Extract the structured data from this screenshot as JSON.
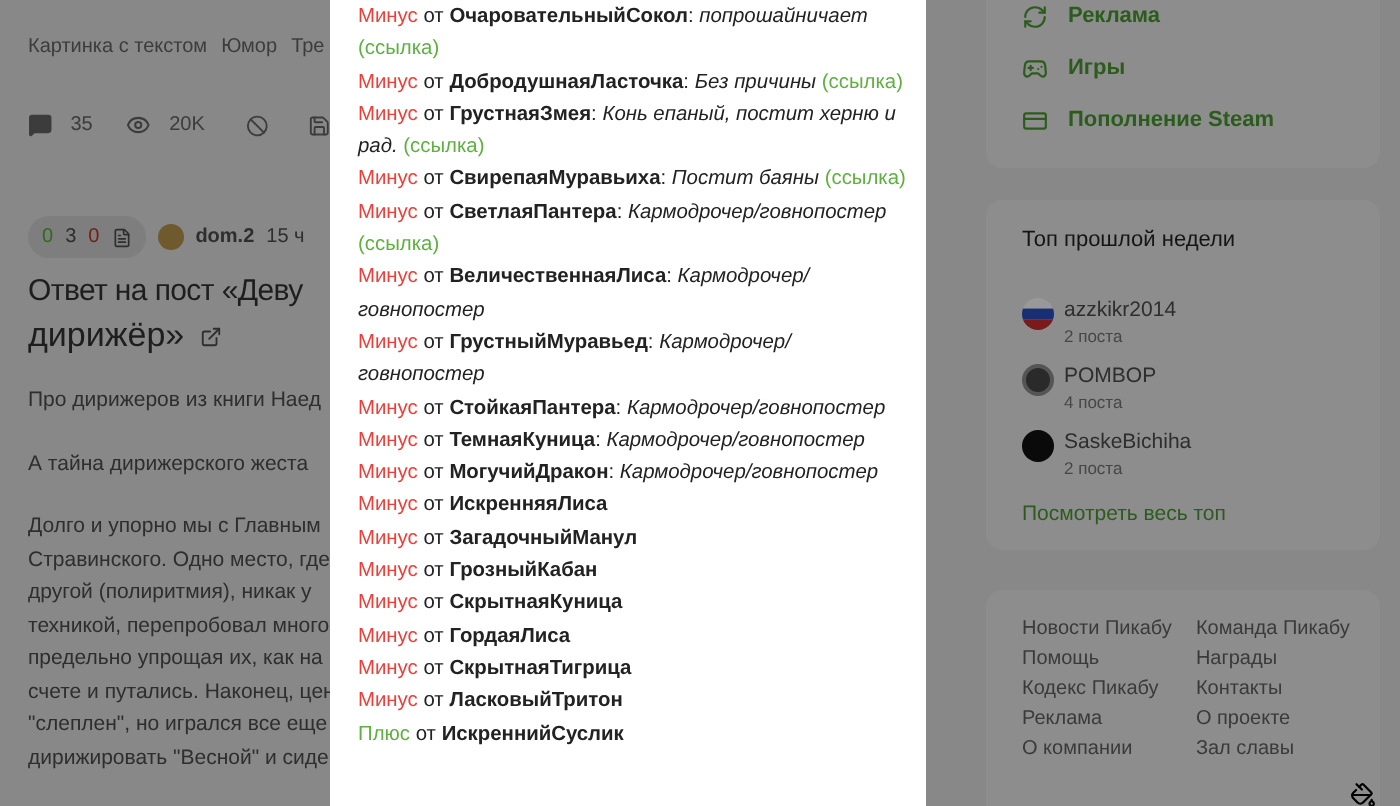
{
  "post_header": {
    "tags": [
      "Картинка с текстом",
      "Юмор",
      "Тре"
    ],
    "stats": {
      "comments": "35",
      "views": "20K"
    }
  },
  "post": {
    "rating": {
      "plus": "0",
      "total": "3",
      "minus": "0"
    },
    "author": "dom.2",
    "time": "15 ч",
    "title_lines": [
      "Ответ на пост «Деву",
      "дирижёр»"
    ],
    "paragraphs": [
      [
        "Про дирижеров из книги Наед"
      ],
      [
        "А тайна дирижерского жеста"
      ],
      [
        "Долго и упорно мы с Главным",
        "Стравинского. Одно место, где",
        "другой (полиритмия), никак у",
        "техникой, перепробовал много",
        "предельно упрощая их, как на",
        "счете и путались. Наконец, цен",
        "\"слеплен\", но игрался все еще",
        "дирижировать \"Весной\" и сиде"
      ]
    ]
  },
  "votes": [
    {
      "kind": "minus",
      "label": "Минус",
      "from": "от",
      "user": "ОчаровательныйСокол",
      "sep": ":",
      "reason": "попрошайничает",
      "link": "(ссылка)"
    },
    {
      "kind": "minus",
      "label": "Минус",
      "from": "от",
      "user": "ДобродушнаяЛасточка",
      "sep": ":",
      "reason": "Без причины",
      "link": "(ссылка)"
    },
    {
      "kind": "minus",
      "label": "Минус",
      "from": "от",
      "user": "ГрустнаяЗмея",
      "sep": ":",
      "reason": "Конь епаный, постит херню и рад.",
      "link": "(ссылка)"
    },
    {
      "kind": "minus",
      "label": "Минус",
      "from": "от",
      "user": "СвирепаяМуравьиха",
      "sep": ":",
      "reason": "Постит баяны",
      "link": "(ссылка)"
    },
    {
      "kind": "minus",
      "label": "Минус",
      "from": "от",
      "user": "СветлаяПантера",
      "sep": ":",
      "reason": "Кармодрочер/говнопостер",
      "link": "(ссылка)"
    },
    {
      "kind": "minus",
      "label": "Минус",
      "from": "от",
      "user": "ВеличественнаяЛиса",
      "sep": ":",
      "reason": "Кармодрочер/ говнопостер"
    },
    {
      "kind": "minus",
      "label": "Минус",
      "from": "от",
      "user": "ГрустныйМуравьед",
      "sep": ":",
      "reason": "Кармодрочер/ говнопостер"
    },
    {
      "kind": "minus",
      "label": "Минус",
      "from": "от",
      "user": "СтойкаяПантера",
      "sep": ":",
      "reason": "Кармодрочер/говнопостер"
    },
    {
      "kind": "minus",
      "label": "Минус",
      "from": "от",
      "user": "ТемнаяКуница",
      "sep": ":",
      "reason": "Кармодрочер/говнопостер"
    },
    {
      "kind": "minus",
      "label": "Минус",
      "from": "от",
      "user": "МогучийДракон",
      "sep": ":",
      "reason": "Кармодрочер/говнопостер"
    },
    {
      "kind": "minus",
      "label": "Минус",
      "from": "от",
      "user": "ИскренняяЛиса"
    },
    {
      "kind": "minus",
      "label": "Минус",
      "from": "от",
      "user": "ЗагадочныйМанул"
    },
    {
      "kind": "minus",
      "label": "Минус",
      "from": "от",
      "user": "ГрозныйКабан"
    },
    {
      "kind": "minus",
      "label": "Минус",
      "from": "от",
      "user": "СкрытнаяКуница"
    },
    {
      "kind": "minus",
      "label": "Минус",
      "from": "от",
      "user": "ГордаяЛиса"
    },
    {
      "kind": "minus",
      "label": "Минус",
      "from": "от",
      "user": "СкрытнаяТигрица"
    },
    {
      "kind": "minus",
      "label": "Минус",
      "from": "от",
      "user": "ЛасковыйТритон"
    },
    {
      "kind": "plus",
      "label": "Плюс",
      "from": "от",
      "user": "ИскреннийСуслик"
    }
  ],
  "sidebar_menu": [
    {
      "kind": "ads",
      "label": "Реклама"
    },
    {
      "kind": "games",
      "label": "Игры"
    },
    {
      "kind": "card",
      "label": "Пополнение Steam"
    }
  ],
  "top_week": {
    "title": "Топ прошлой недели",
    "users": [
      {
        "kind": "flag",
        "name": "azzkikr2014",
        "posts": "2 поста"
      },
      {
        "kind": "dark",
        "name": "POMBOP",
        "posts": "4 поста"
      },
      {
        "kind": "black",
        "name": "SaskeBichiha",
        "posts": "2 поста"
      }
    ],
    "more": "Посмотреть весь топ"
  },
  "footer_links": [
    [
      "Новости Пикабу",
      "Помощь",
      "Кодекс Пикабу",
      "Реклама",
      "О компании"
    ],
    [
      "Команда Пикабу",
      "Награды",
      "Контакты",
      "О проекте",
      "Зал славы"
    ]
  ]
}
